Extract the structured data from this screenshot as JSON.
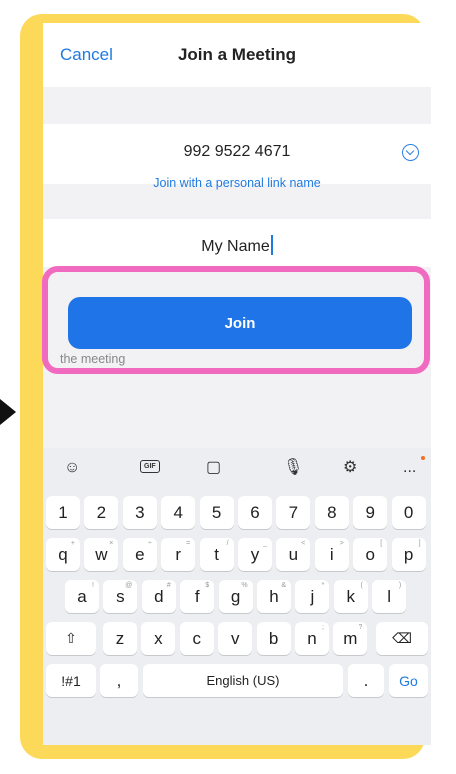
{
  "header": {
    "cancel_label": "Cancel",
    "title": "Join a Meeting"
  },
  "meeting_id": {
    "value": "992 9522 4671",
    "dropdown_icon": "chevron-down-circle-icon"
  },
  "personal_link_label": "Join with a personal link name",
  "display_name": {
    "value": "My Name"
  },
  "join_label": "Join",
  "hint_text": "the meeting",
  "keyboard": {
    "toolbar": [
      "smiley-icon",
      "gif-icon",
      "sticker-icon",
      "microphone-icon",
      "settings-icon",
      "more-icon"
    ],
    "gif_label": "GIF",
    "more_label": "...",
    "number_row": [
      "1",
      "2",
      "3",
      "4",
      "5",
      "6",
      "7",
      "8",
      "9",
      "0"
    ],
    "row1": [
      "q",
      "w",
      "e",
      "r",
      "t",
      "y",
      "u",
      "i",
      "o",
      "p"
    ],
    "row1_sub": [
      "+",
      "×",
      "÷",
      "=",
      "/",
      "_",
      "<",
      ">",
      "[",
      "]"
    ],
    "row2": [
      "a",
      "s",
      "d",
      "f",
      "g",
      "h",
      "j",
      "k",
      "l"
    ],
    "row2_sub": [
      "!",
      "@",
      "#",
      "$",
      "%",
      "&",
      "*",
      "(",
      ")"
    ],
    "row3": [
      "z",
      "x",
      "c",
      "v",
      "b",
      "n",
      "m"
    ],
    "row3_sub": [
      "",
      "",
      "",
      "",
      "",
      ";",
      "?"
    ],
    "symbols_label": "!#1",
    "comma_label": ",",
    "space_label": "English (US)",
    "period_label": ".",
    "go_label": "Go",
    "shift_glyph": "⇧",
    "backspace_glyph": "⌫"
  },
  "colors": {
    "accent": "#1f74e8",
    "frame": "#fdd95a",
    "highlight": "#f06bbf"
  }
}
